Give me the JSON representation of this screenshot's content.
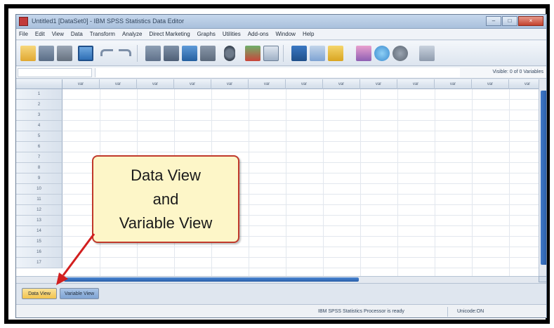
{
  "window": {
    "title": "Untitled1 [DataSet0] - IBM SPSS Statistics Data Editor",
    "controls": [
      "–",
      "□",
      "×"
    ]
  },
  "menu": [
    "File",
    "Edit",
    "View",
    "Data",
    "Transform",
    "Analyze",
    "Direct Marketing",
    "Graphs",
    "Utilities",
    "Add-ons",
    "Window",
    "Help"
  ],
  "toolbar_icons": [
    "open-folder-icon",
    "save-icon",
    "print-icon",
    "dialog-recall-icon",
    "undo-icon",
    "redo-icon",
    "goto-case-icon",
    "goto-variable-icon",
    "variables-icon",
    "run-descriptive-icon",
    "find-icon",
    "insert-cases-icon",
    "insert-variable-icon",
    "split-file-icon",
    "weight-cases-icon",
    "select-cases-icon",
    "value-labels-icon",
    "use-variable-sets-icon",
    "show-all-variables-icon",
    "spell-check-icon"
  ],
  "refbar": {
    "visible": "Visible: 0 of 0 Variables"
  },
  "grid": {
    "column_header": "var",
    "row_numbers": [
      "1",
      "2",
      "3",
      "4",
      "5",
      "6",
      "7",
      "8",
      "9",
      "10",
      "11",
      "12",
      "13",
      "14",
      "15",
      "16",
      "17"
    ]
  },
  "tabs": {
    "data_view": "Data View",
    "variable_view": "Variable View"
  },
  "status": {
    "processor": "IBM SPSS Statistics Processor is ready",
    "unicode": "Unicode:ON"
  },
  "callout": {
    "line1": "Data View",
    "line2": "and",
    "line3": "Variable View"
  },
  "colors": {
    "accent": "#2a5ea8",
    "callout_border": "#c0392b",
    "callout_fill": "#fdf6c8",
    "active_tab": "#f2c34d"
  }
}
